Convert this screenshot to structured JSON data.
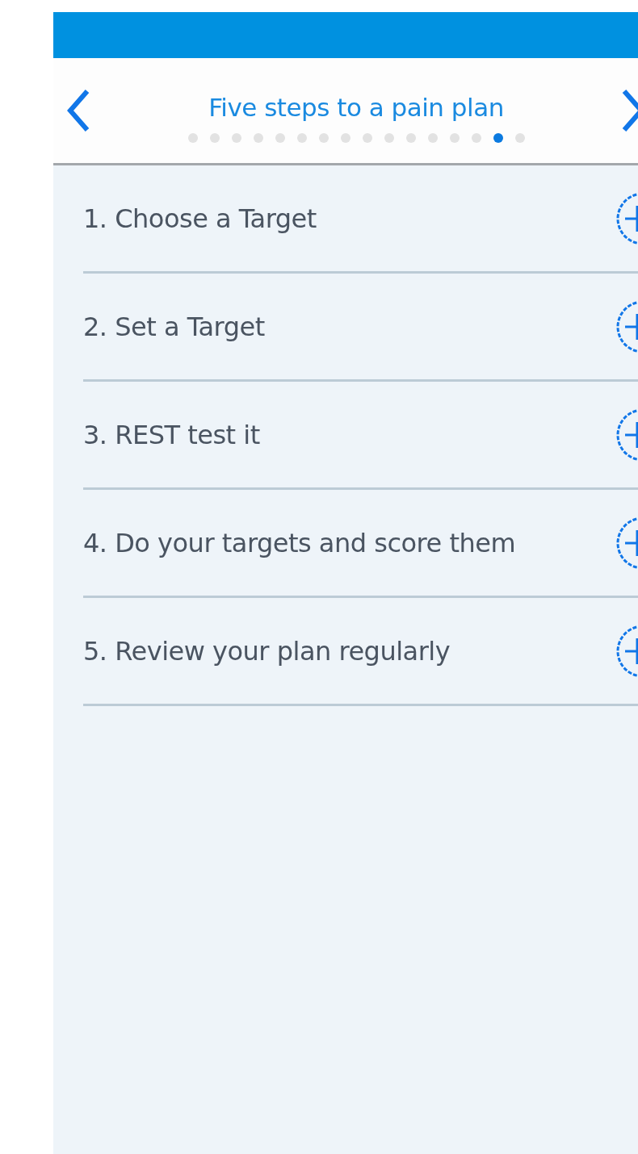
{
  "header": {
    "title": "Five steps to a pain plan"
  },
  "pages": [
    {
      "selected": false
    },
    {
      "selected": false
    },
    {
      "selected": false
    },
    {
      "selected": false
    },
    {
      "selected": false
    },
    {
      "selected": false
    },
    {
      "selected": false
    },
    {
      "selected": false
    },
    {
      "selected": false
    },
    {
      "selected": false
    },
    {
      "selected": false
    },
    {
      "selected": false
    },
    {
      "selected": false
    },
    {
      "selected": false
    },
    {
      "selected": true
    },
    {
      "selected": false
    }
  ],
  "steps": [
    {
      "label": "1. Choose a Target"
    },
    {
      "label": "2. Set a Target"
    },
    {
      "label": "3. REST test it"
    },
    {
      "label": "4. Do your targets and score them"
    },
    {
      "label": "5. Review your plan regularly"
    }
  ]
}
